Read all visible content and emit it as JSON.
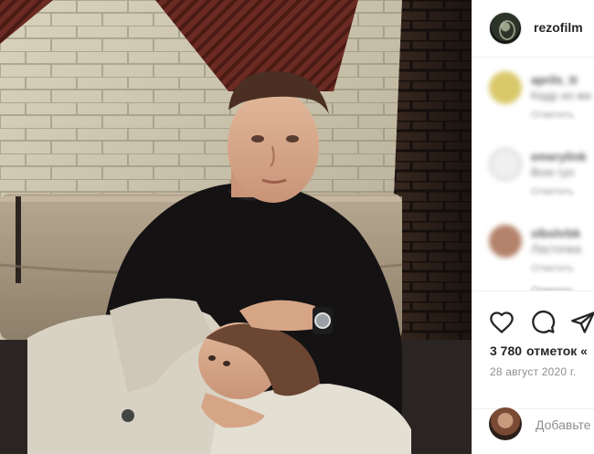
{
  "post": {
    "username": "rezofilm",
    "likes_count": "3 780",
    "likes_label": "отметок «",
    "date": "28 август 2020 г.",
    "comment_placeholder": "Добавьте"
  },
  "comments": [
    {
      "user": "aprils_tt",
      "text": "Кадр из жи",
      "meta": "Ответить"
    },
    {
      "user": "emerylink",
      "text": "Bow  гуо",
      "meta": "Ответить"
    },
    {
      "user": "slbshrbk",
      "text": "Ласточка",
      "meta": "Ответить"
    }
  ],
  "partial_meta": "Ответить",
  "icons": {
    "heart": "heart-icon",
    "comment": "comment-icon",
    "share": "share-icon"
  },
  "colors": {
    "text": "#262626",
    "secondary": "#8e8e8e",
    "divider": "#efefef"
  }
}
